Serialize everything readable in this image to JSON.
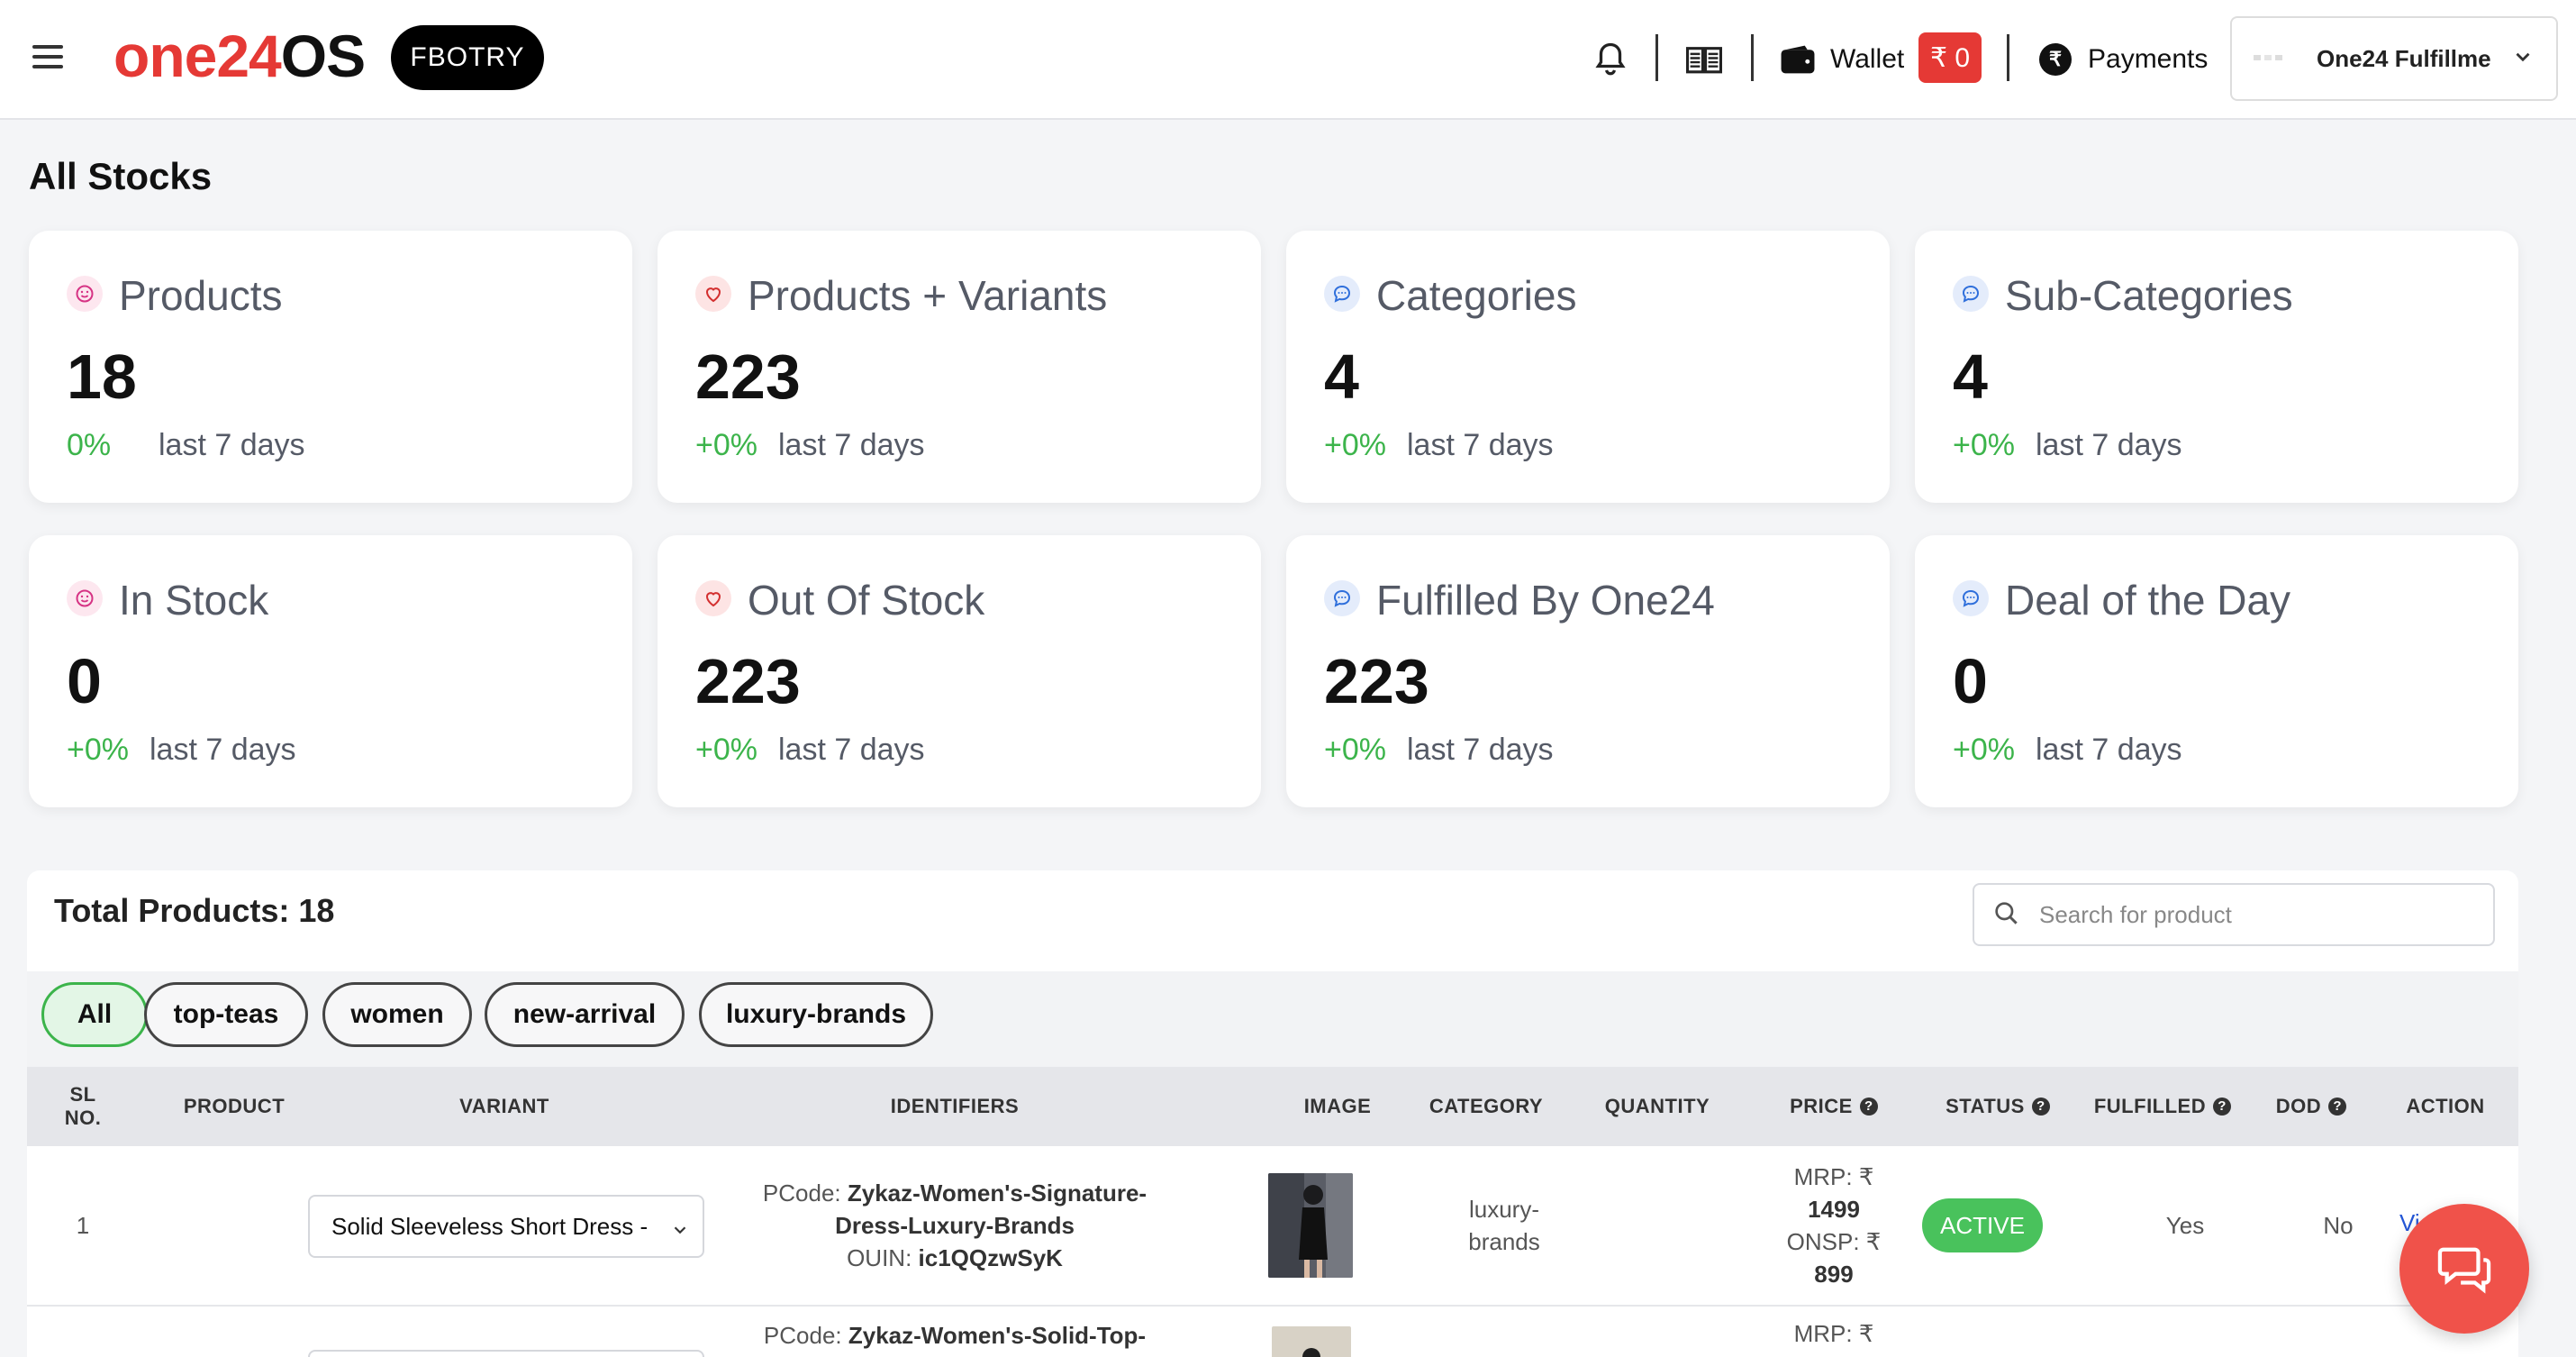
{
  "header": {
    "logo_part1": "one24",
    "logo_part2": "OS",
    "org_badge": "FBOTRY",
    "wallet_label": "Wallet",
    "wallet_balance": "₹ 0",
    "payments_label": "Payments",
    "payments_icon": "₹",
    "account_name": "One24 Fulfillme",
    "brand_color": "#e53935"
  },
  "page": {
    "title": "All Stocks"
  },
  "stats": [
    {
      "label": "Products",
      "value": "18",
      "delta": "0%",
      "period": "last 7 days",
      "icon": "smile-icon"
    },
    {
      "label": "Products + Variants",
      "value": "223",
      "delta": "+0%",
      "period": "last 7 days",
      "icon": "heart-icon"
    },
    {
      "label": "Categories",
      "value": "4",
      "delta": "+0%",
      "period": "last 7 days",
      "icon": "chat-icon"
    },
    {
      "label": "Sub-Categories",
      "value": "4",
      "delta": "+0%",
      "period": "last 7 days",
      "icon": "chat-icon"
    },
    {
      "label": "In Stock",
      "value": "0",
      "delta": "+0%",
      "period": "last 7 days",
      "icon": "smile-icon"
    },
    {
      "label": "Out Of Stock",
      "value": "223",
      "delta": "+0%",
      "period": "last 7 days",
      "icon": "heart-icon"
    },
    {
      "label": "Fulfilled By One24",
      "value": "223",
      "delta": "+0%",
      "period": "last 7 days",
      "icon": "chat-icon"
    },
    {
      "label": "Deal of the Day",
      "value": "0",
      "delta": "+0%",
      "period": "last 7 days",
      "icon": "chat-icon"
    }
  ],
  "products": {
    "title": "Total Products: 18",
    "search_placeholder": "Search for product",
    "filters": [
      "All",
      "top-teas",
      "women",
      "new-arrival",
      "luxury-brands"
    ],
    "active_filter": "All",
    "columns": {
      "sl_line1": "SL",
      "sl_line2": "NO.",
      "product": "PRODUCT",
      "variant": "VARIANT",
      "identifiers": "IDENTIFIERS",
      "image": "IMAGE",
      "category": "CATEGORY",
      "quantity": "QUANTITY",
      "price": "PRICE",
      "status": "STATUS",
      "fulfilled": "FULFILLED",
      "dod": "DOD",
      "action": "ACTION"
    },
    "rows": [
      {
        "sl": "1",
        "variant": "Solid Sleeveless Short Dress -",
        "pcode_label": "PCode:",
        "pcode_line1": "Zykaz-Women's-Signature-",
        "pcode_line2": "Dress-Luxury-Brands",
        "ouin_label": "OUIN:",
        "ouin": "ic1QQzwSyK",
        "category_line1": "luxury-",
        "category_line2": "brands",
        "mrp_label": "MRP: ₹",
        "mrp": "1499",
        "onsp_label": "ONSP: ₹",
        "onsp": "899",
        "status": "ACTIVE",
        "fulfilled": "Yes",
        "dod": "No",
        "action": "Vi"
      },
      {
        "pcode_label": "PCode:",
        "pcode_line1": "Zykaz-Women's-Solid-Top-",
        "mrp_label": "MRP: ₹"
      }
    ]
  },
  "colors": {
    "positive": "#3cb44b",
    "status_active": "#49c25c",
    "chat_fab": "#f0524a",
    "link": "#2456d6"
  }
}
